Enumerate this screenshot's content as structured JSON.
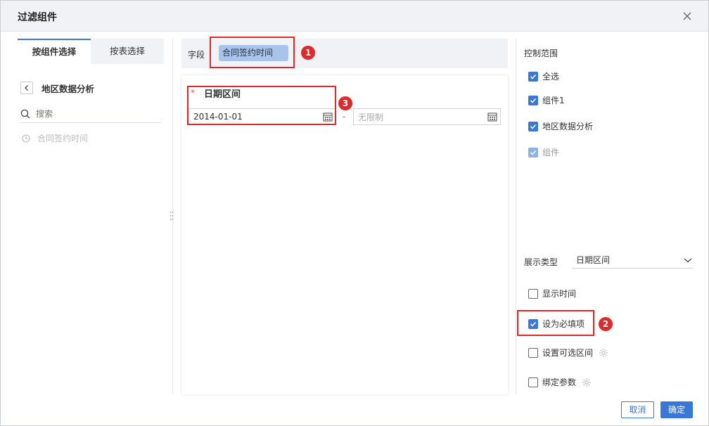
{
  "dialog": {
    "title": "过滤组件"
  },
  "left": {
    "tabs": [
      {
        "label": "按组件选择",
        "active": true
      },
      {
        "label": "按表选择",
        "active": false
      }
    ],
    "back_label": "地区数据分析",
    "search_placeholder": "搜索",
    "field_item": "合同签约时间"
  },
  "center": {
    "field_label": "字段",
    "field_chip": "合同签约时间",
    "required_mark": "*",
    "range_title": "日期区间",
    "start_date": "2014-01-01",
    "separator": "-",
    "end_placeholder": "无限制"
  },
  "right": {
    "control_scope_title": "控制范围",
    "scope_items": [
      {
        "label": "全选",
        "checked": true
      },
      {
        "label": "组件1",
        "checked": true
      },
      {
        "label": "地区数据分析",
        "checked": true
      },
      {
        "label": "组件",
        "checked": true,
        "disabled": true
      }
    ],
    "display_type_label": "展示类型",
    "display_type_value": "日期区间",
    "options": [
      {
        "label": "显示时间",
        "checked": false
      },
      {
        "label": "设为必填项",
        "checked": true
      },
      {
        "label": "设置可选区间",
        "checked": false,
        "gear": true
      },
      {
        "label": "绑定参数",
        "checked": false,
        "gear": true
      }
    ]
  },
  "annotations": [
    "1",
    "2",
    "3"
  ],
  "buttons": {
    "cancel": "取消",
    "ok": "确定"
  },
  "colors": {
    "accent": "#3a78d8",
    "annotation": "#e02a2a",
    "chip": "#a9c4ea"
  }
}
